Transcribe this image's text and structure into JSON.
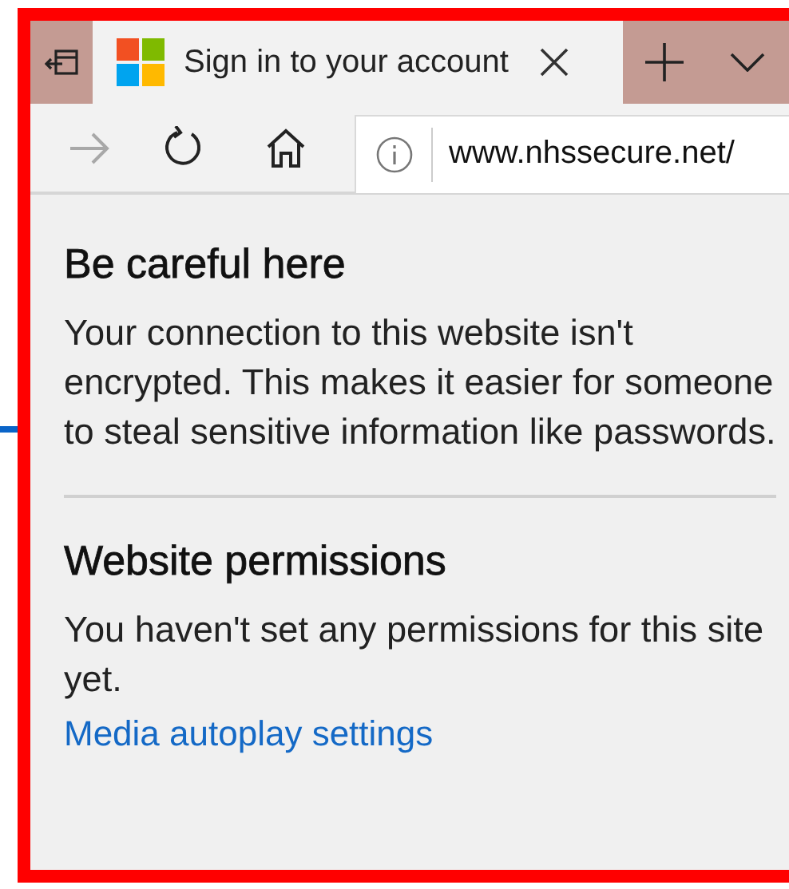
{
  "tab_bar": {
    "tabs": [
      {
        "title": "Sign in to your account",
        "selected": true
      }
    ]
  },
  "nav": {
    "buttons": [
      {
        "kind": "forward",
        "disabled": true
      },
      {
        "kind": "refresh",
        "disabled": false
      },
      {
        "kind": "home",
        "disabled": false
      }
    ]
  },
  "address_bar": {
    "url": "www.nhssecure.net/"
  },
  "panel": {
    "sections": [
      {
        "heading": "Be careful here",
        "text": "Your connection to this website isn't encrypted. This makes it easier for someone to steal sensitive information like passwords."
      },
      {
        "heading": "Website permissions",
        "text": "You haven't set any permissions for this site yet.",
        "link": "Media autoplay settings"
      }
    ]
  }
}
